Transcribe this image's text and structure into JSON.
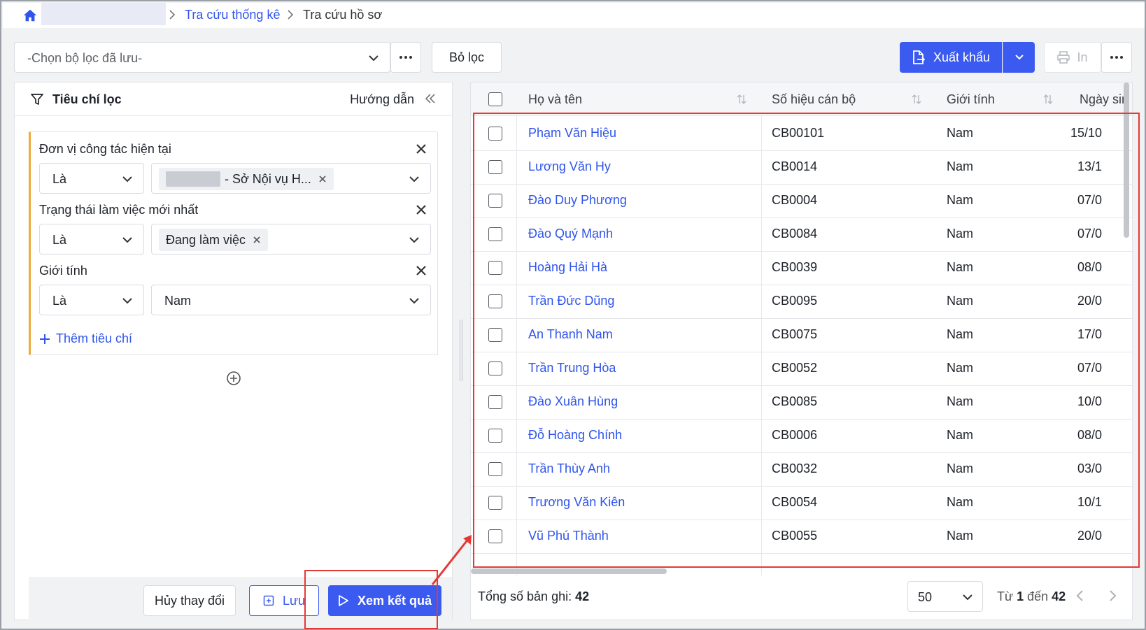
{
  "breadcrumb": {
    "link": "Tra cứu thống kê",
    "current": "Tra cứu hồ sơ"
  },
  "toolbar": {
    "saved_filter_placeholder": "-Chọn bộ lọc đã lưu-",
    "filter_button": "Bỏ lọc",
    "export_button": "Xuất khẩu",
    "print_button": "In"
  },
  "filter_panel": {
    "title": "Tiêu chí lọc",
    "guide": "Hướng dẫn",
    "criteria": [
      {
        "label": "Đơn vị công tác hiện tại",
        "operator": "Là",
        "value": "- Sở Nội vụ H..."
      },
      {
        "label": "Trạng thái làm việc mới nhất",
        "operator": "Là",
        "value": "Đang làm việc"
      },
      {
        "label": "Giới tính",
        "operator": "Là",
        "value": "Nam"
      }
    ],
    "add_criteria": "Thêm tiêu chí",
    "cancel_button": "Hủy thay đổi",
    "save_button": "Lưu",
    "view_button": "Xem kết quả"
  },
  "table": {
    "columns": [
      "Họ và tên",
      "Số hiệu cán bộ",
      "Giới tính",
      "Ngày sin"
    ],
    "rows": [
      {
        "name": "Phạm Văn Hiệu",
        "code": "CB00101",
        "gender": "Nam",
        "date": "15/10"
      },
      {
        "name": "Lương Văn Hy",
        "code": "CB0014",
        "gender": "Nam",
        "date": "13/1"
      },
      {
        "name": "Đào Duy Phương",
        "code": "CB0004",
        "gender": "Nam",
        "date": "07/0"
      },
      {
        "name": "Đào Quý Mạnh",
        "code": "CB0084",
        "gender": "Nam",
        "date": "07/0"
      },
      {
        "name": "Hoàng Hải Hà",
        "code": "CB0039",
        "gender": "Nam",
        "date": "08/0"
      },
      {
        "name": "Trần Đức Dũng",
        "code": "CB0095",
        "gender": "Nam",
        "date": "20/0"
      },
      {
        "name": "An Thanh Nam",
        "code": "CB0075",
        "gender": "Nam",
        "date": "17/0"
      },
      {
        "name": "Trần Trung Hòa",
        "code": "CB0052",
        "gender": "Nam",
        "date": "07/0"
      },
      {
        "name": "Đào Xuân Hùng",
        "code": "CB0085",
        "gender": "Nam",
        "date": "10/0"
      },
      {
        "name": "Đỗ Hoàng Chính",
        "code": "CB0006",
        "gender": "Nam",
        "date": "08/0"
      },
      {
        "name": "Trần Thùy Anh",
        "code": "CB0032",
        "gender": "Nam",
        "date": "03/0"
      },
      {
        "name": "Trương Văn Kiên",
        "code": "CB0054",
        "gender": "Nam",
        "date": "10/1"
      },
      {
        "name": "Vũ Phú Thành",
        "code": "CB0055",
        "gender": "Nam",
        "date": "20/0"
      }
    ],
    "total_label": "Tổng số bản ghi:",
    "total_count": "42",
    "page_size": "50",
    "range_from_label": "Từ",
    "range_from": "1",
    "range_to_label": "đến",
    "range_to": "42"
  },
  "colors": {
    "primary": "#3a5af0",
    "link": "#2f54eb",
    "accent_border": "#f0a93b",
    "annotation": "#e53935"
  }
}
